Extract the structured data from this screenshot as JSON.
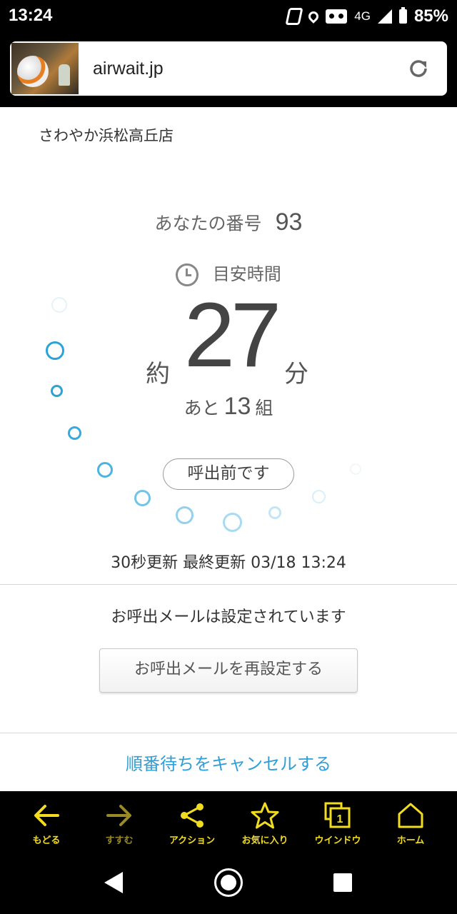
{
  "status_bar": {
    "time": "13:24",
    "network": "4G",
    "battery": "85%",
    "icons": [
      "nfc-icon",
      "location-icon",
      "vr-icon",
      "signal-icon",
      "battery-icon"
    ]
  },
  "browser": {
    "url": "airwait.jp",
    "reload_icon": "reload-icon",
    "thumbnail": "page-thumbnail"
  },
  "page": {
    "store_name": "さわやか浜松高丘店",
    "your_number_label": "あなたの番号",
    "your_number": "93",
    "estimate_label": "目安時間",
    "wait_prefix": "約",
    "wait_minutes": "27",
    "wait_unit": "分",
    "remaining_prefix": "あと",
    "remaining_groups": "13",
    "remaining_suffix": "組",
    "status_pill": "呼出前です",
    "refresh_info": "30秒更新 最終更新 03/18 13:24",
    "mail_status": "お呼出メールは設定されています",
    "reset_mail_button": "お呼出メールを再設定する",
    "cancel_link": "順番待ちをキャンセルする",
    "accent_color": "#2f9fd7"
  },
  "toolbar": {
    "items": [
      {
        "label": "もどる",
        "icon": "arrow-left-icon"
      },
      {
        "label": "すすむ",
        "icon": "arrow-right-icon"
      },
      {
        "label": "アクション",
        "icon": "share-icon"
      },
      {
        "label": "お気に入り",
        "icon": "star-icon"
      },
      {
        "label": "ウインドウ",
        "icon": "window-icon",
        "badge": "1"
      },
      {
        "label": "ホーム",
        "icon": "home-icon"
      }
    ],
    "color": "#f2dc1f"
  },
  "navbar": {
    "icons": [
      "back-icon",
      "home-circle-icon",
      "recents-icon"
    ]
  }
}
